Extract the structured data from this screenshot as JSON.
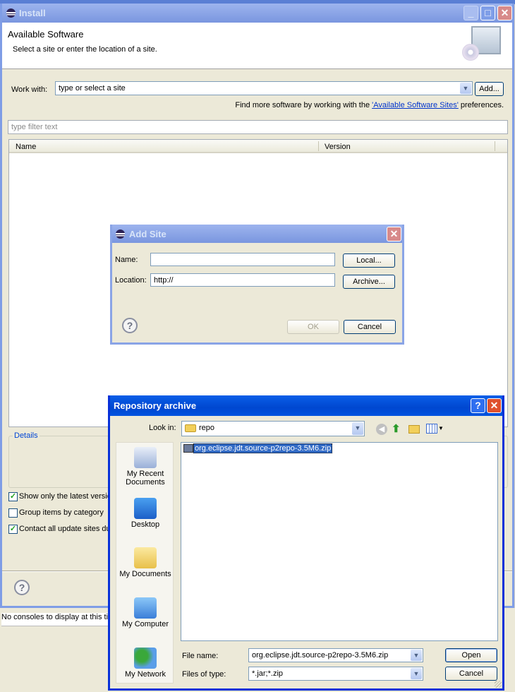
{
  "install": {
    "title": "Install",
    "header_title": "Available Software",
    "header_subtitle": "Select a site or enter the location of a site.",
    "work_with_label": "Work with:",
    "work_with_value": "type or select a site",
    "add_button": "Add...",
    "find_more_prefix": "Find more software by working with the ",
    "find_more_link": "'Available Software Sites'",
    "find_more_suffix": " preferences.",
    "filter_placeholder": "type filter text",
    "columns": [
      "Name",
      "Version"
    ],
    "details_label": "Details",
    "checkboxes": [
      {
        "label": "Show only the latest versio",
        "checked": true
      },
      {
        "label": "Group items by category",
        "checked": false
      },
      {
        "label": "Contact all update sites du",
        "checked": true
      }
    ]
  },
  "console_text": "No consoles to display at this tin",
  "add_site": {
    "title": "Add Site",
    "name_label": "Name:",
    "name_value": "",
    "location_label": "Location:",
    "location_value": "http://",
    "local_button": "Local...",
    "archive_button": "Archive...",
    "ok_button": "OK",
    "cancel_button": "Cancel"
  },
  "repo": {
    "title": "Repository archive",
    "look_in_label": "Look in:",
    "look_in_value": "repo",
    "places": [
      "My Recent Documents",
      "Desktop",
      "My Documents",
      "My Computer",
      "My Network"
    ],
    "files": [
      "org.eclipse.jdt.source-p2repo-3.5M6.zip"
    ],
    "file_name_label": "File name:",
    "file_name_value": "org.eclipse.jdt.source-p2repo-3.5M6.zip",
    "file_type_label": "Files of type:",
    "file_type_value": "*.jar;*.zip",
    "open_button": "Open",
    "cancel_button": "Cancel"
  }
}
